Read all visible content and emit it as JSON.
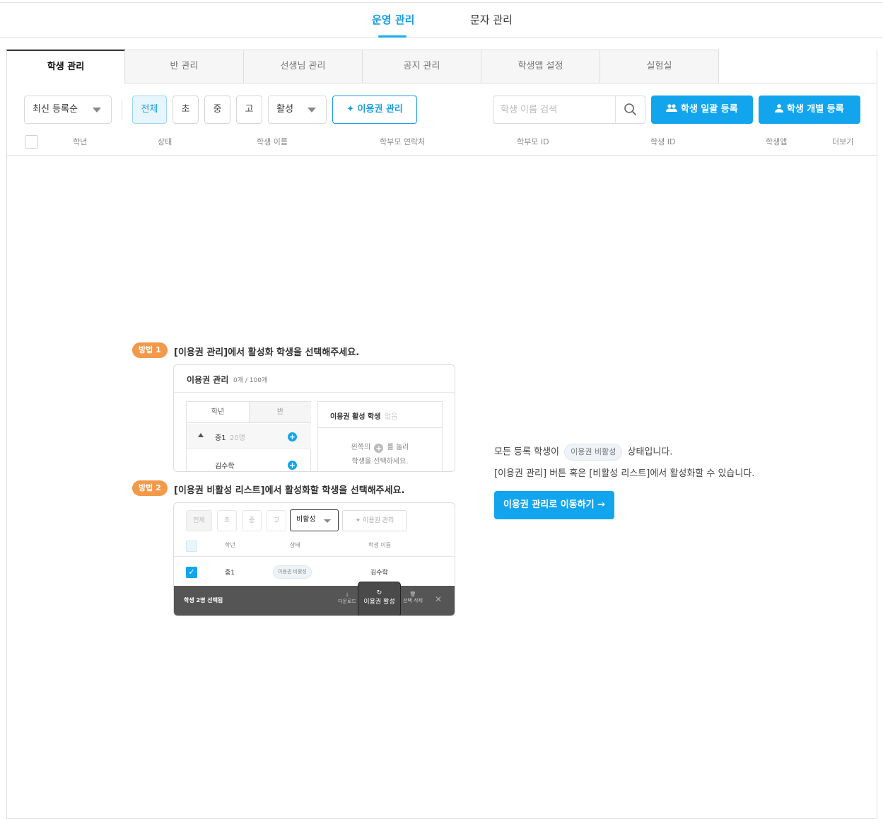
{
  "top_nav": {
    "tabs": [
      {
        "label": "운영 관리"
      },
      {
        "label": "문자 관리"
      }
    ]
  },
  "sub_tabs": [
    {
      "label": "학생 관리"
    },
    {
      "label": "반 관리"
    },
    {
      "label": "선생님 관리"
    },
    {
      "label": "공지 관리"
    },
    {
      "label": "학생앱 설정"
    },
    {
      "label": "실험실"
    }
  ],
  "toolbar": {
    "sort_value": "최신 등록순",
    "grade_filters": [
      "전체",
      "초",
      "중",
      "고"
    ],
    "status_value": "활성",
    "license_button": "이용권 관리",
    "search_placeholder": "학생 이름 검색",
    "bulk_register": "학생 일괄 등록",
    "single_register": "학생 개별 등록"
  },
  "table": {
    "headers": [
      "학년",
      "상태",
      "학생 이름",
      "학부모 연락처",
      "학부모 ID",
      "학생 ID",
      "학생앱",
      "더보기"
    ]
  },
  "guide": {
    "step1": {
      "badge": "방법 1",
      "title": "[이용권 관리]에서 활성화 학생을 선택해주세요.",
      "card_title": "이용권 관리",
      "card_count": "0개 / 100개",
      "tab_grade": "학년",
      "tab_class": "반",
      "group_name": "중1",
      "group_count": "20명",
      "student_name": "김수학",
      "active_title": "이용권 활성 학생",
      "active_empty": "없음",
      "hint_prefix": "왼쪽의",
      "hint_suffix": "를 눌러",
      "hint_line2": "학생을 선택하세요."
    },
    "step2": {
      "badge": "방법 2",
      "title": "[이용권 비활성 리스트]에서 활성화할 학생을 선택해주세요.",
      "filters": [
        "전체",
        "초",
        "중",
        "고"
      ],
      "status_value": "비활성",
      "license_button": "이용권 관리",
      "headers": [
        "학년",
        "상태",
        "학생 이름"
      ],
      "row": {
        "grade": "중1",
        "status": "이용권 비활성",
        "name": "김수학"
      },
      "selection_text": "학생 2명 선택됨",
      "actions": [
        "다운로드",
        "이용권 활성",
        "선택 삭제"
      ]
    }
  },
  "empty_state": {
    "line1_prefix": "모든 등록 학생이",
    "status_tag": "이용권 비활성",
    "line1_suffix": "상태입니다.",
    "line2": "[이용권 관리] 버튼 혹은 [비활성 리스트]에서 활성화할 수 있습니다.",
    "button": "이용권 관리로 이동하기 →"
  }
}
